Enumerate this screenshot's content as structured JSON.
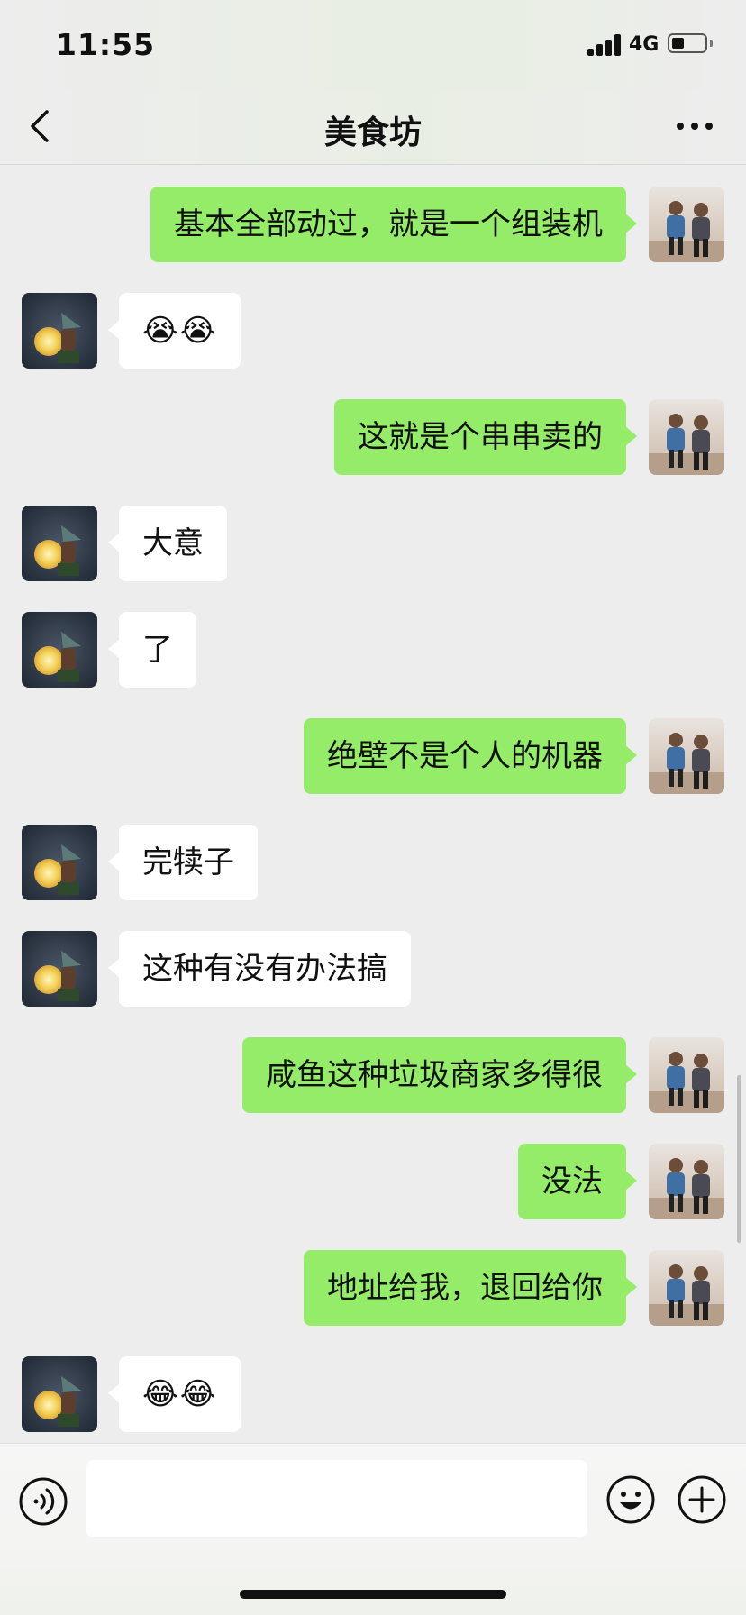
{
  "status_bar": {
    "time": "11:55",
    "network": "4G",
    "battery_level": 0.35
  },
  "header": {
    "title": "美食坊"
  },
  "messages": [
    {
      "side": "right",
      "text": "基本全部动过，就是一个组装机"
    },
    {
      "side": "left",
      "text": "😭😭"
    },
    {
      "side": "right",
      "text": "这就是个串串卖的"
    },
    {
      "side": "left",
      "text": "大意"
    },
    {
      "side": "left",
      "text": "了"
    },
    {
      "side": "right",
      "text": "绝壁不是个人的机器"
    },
    {
      "side": "left",
      "text": "完犊子"
    },
    {
      "side": "left",
      "text": "这种有没有办法搞"
    },
    {
      "side": "right",
      "text": "咸鱼这种垃圾商家多得很"
    },
    {
      "side": "right",
      "text": "没法"
    },
    {
      "side": "right",
      "text": "地址给我，退回给你"
    },
    {
      "side": "left",
      "text": "😂😂"
    }
  ],
  "input_bar": {
    "value": "",
    "placeholder": ""
  },
  "icons": {
    "back": "chevron-left-icon",
    "more": "more-dots-icon",
    "voice": "voice-icon",
    "emoji": "emoji-smile-icon",
    "plus": "plus-circle-icon"
  },
  "colors": {
    "my_bubble": "#95ec69",
    "their_bubble": "#ffffff",
    "background": "#ededed"
  }
}
